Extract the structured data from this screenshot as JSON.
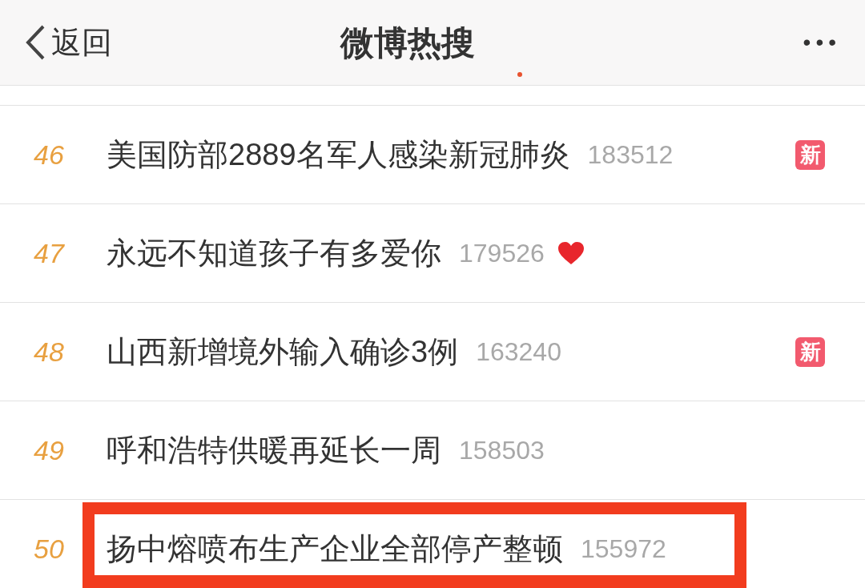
{
  "nav": {
    "back": "返回",
    "title": "微博热搜",
    "more": "•••"
  },
  "rows": [
    {
      "rank": "46",
      "title": "美国防部2889名军人感染新冠肺炎",
      "count": "183512",
      "badge": {
        "kind": "new",
        "text": "新"
      },
      "highlighted": false
    },
    {
      "rank": "47",
      "title": "永远不知道孩子有多爱你",
      "count": "179526",
      "badge": {
        "kind": "heart"
      },
      "highlighted": false
    },
    {
      "rank": "48",
      "title": "山西新增境外输入确诊3例",
      "count": "163240",
      "badge": {
        "kind": "new",
        "text": "新"
      },
      "highlighted": false
    },
    {
      "rank": "49",
      "title": "呼和浩特供暖再延长一周",
      "count": "158503",
      "highlighted": false
    },
    {
      "rank": "50",
      "title": "扬中熔喷布生产企业全部停产整顿",
      "count": "155972",
      "highlighted": true
    }
  ]
}
